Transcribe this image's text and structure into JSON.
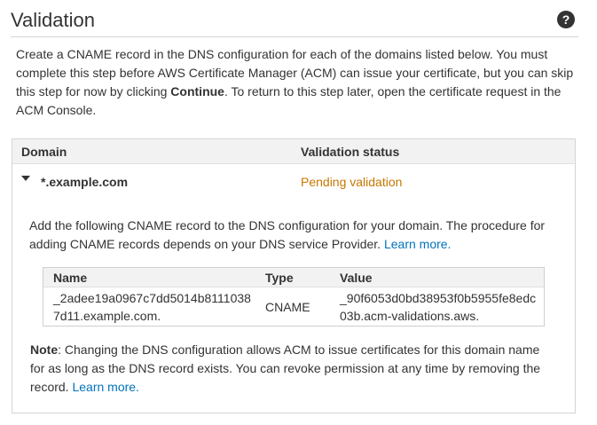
{
  "header": {
    "title": "Validation",
    "help_icon": "question-circle-icon"
  },
  "intro": {
    "part1": "Create a CNAME record in the DNS configuration for each of the domains listed below. You must complete this step before AWS Certificate Manager (ACM) can issue your certificate, but you can skip this step for now by clicking ",
    "continue_word": "Continue",
    "part2": ". To return to this step later, open the certificate request in the ACM Console."
  },
  "table": {
    "columns": [
      "Domain",
      "Validation status"
    ],
    "rows": [
      {
        "domain": "*.example.com",
        "status": "Pending validation",
        "expanded": true,
        "expand_icon": "caret-down-icon"
      }
    ]
  },
  "detail": {
    "text": "Add the following CNAME record to the DNS configuration for your domain. The procedure for adding CNAME records depends on your DNS service Provider. ",
    "link": "Learn more."
  },
  "record_table": {
    "columns": [
      "Name",
      "Type",
      "Value"
    ],
    "rows": [
      {
        "name_line1": "_2adee19a0967c7dd5014b8111038",
        "name_line2": "7d11.example.com.",
        "type": "CNAME",
        "value_line1": "_90f6053d0bd38953f0b5955fe8edc",
        "value_line2": "03b.acm-validations.aws."
      }
    ]
  },
  "note": {
    "label": "Note",
    "text": ": Changing the DNS configuration allows ACM to issue certificates for this domain name for as long as the DNS record exists. You can revoke permission at any time by removing the record. ",
    "link": "Learn more."
  },
  "colors": {
    "pending": "#c77700",
    "link": "#0073bb",
    "header_bg": "#f2f2f2"
  }
}
